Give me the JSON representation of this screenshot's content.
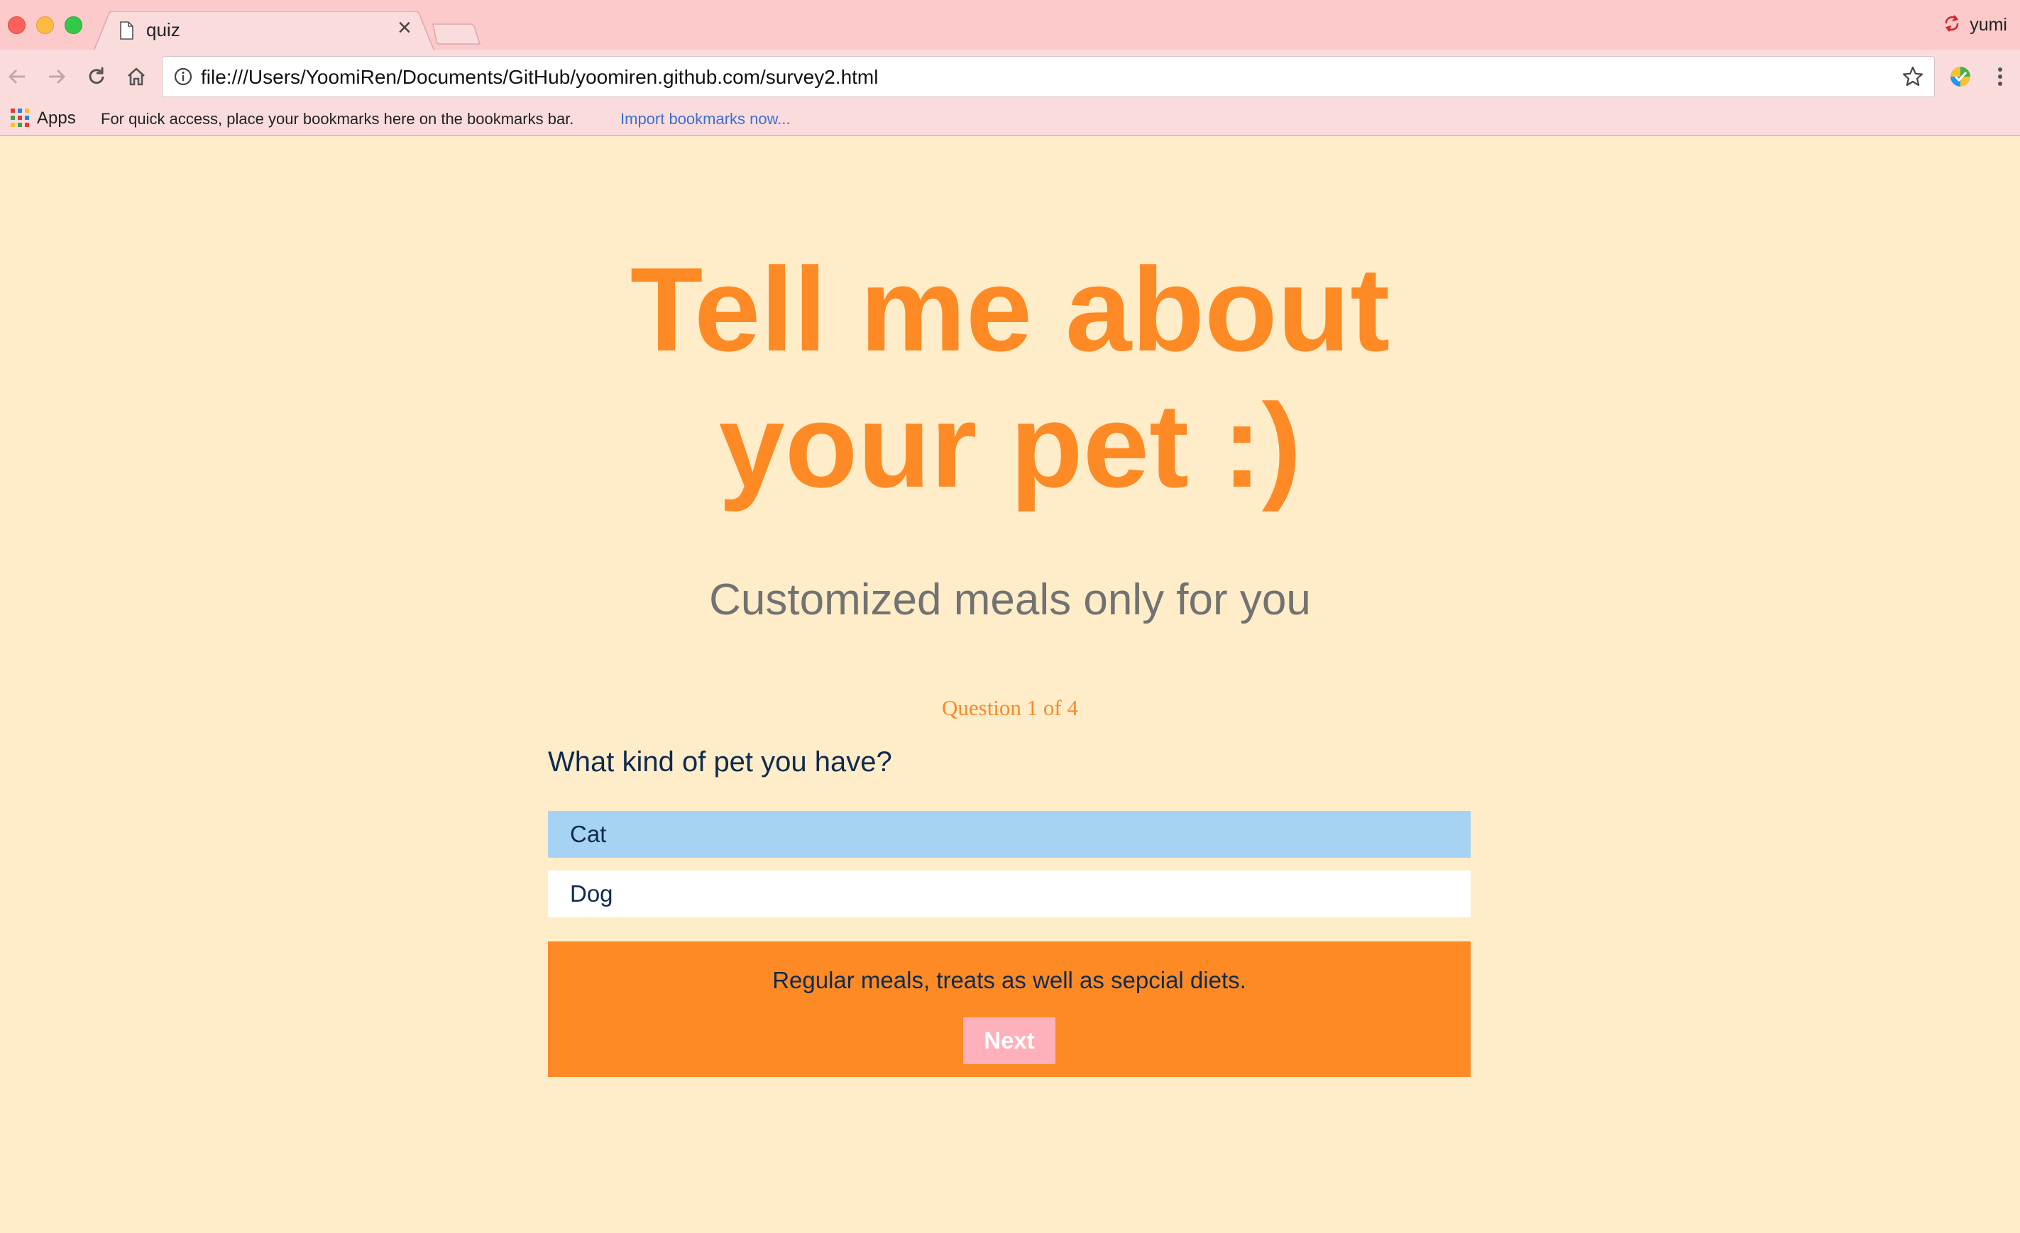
{
  "browser": {
    "tab": {
      "title": "quiz",
      "close_glyph": "×"
    },
    "profile": {
      "name": "yumi"
    },
    "address": {
      "url": "file:///Users/YoomiRen/Documents/GitHub/yoomiren.github.com/survey2.html"
    },
    "bookmarks_bar": {
      "apps_label": "Apps",
      "hint": "For quick access, place your bookmarks here on the bookmarks bar.",
      "import_link": "Import bookmarks now..."
    },
    "icons": [
      "page-icon",
      "back-icon",
      "forward-icon",
      "reload-icon",
      "home-icon",
      "info-icon",
      "star-icon",
      "extension-icon",
      "menu-icon",
      "apps-icon",
      "sync-icon"
    ]
  },
  "page": {
    "headline_line1": "Tell me about",
    "headline_line2": "your pet :)",
    "subheadline": "Customized meals only for you",
    "progress": "Question 1 of 4",
    "question": "What kind of pet you have?",
    "options": [
      {
        "label": "Cat",
        "selected": true
      },
      {
        "label": "Dog",
        "selected": false
      }
    ],
    "footer_text": "Regular meals, treats as well as sepcial diets.",
    "next_label": "Next"
  },
  "colors": {
    "page_background": "#feedc8",
    "accent_orange": "#fe8a26",
    "selected_option": "#a6d3f3",
    "next_button": "#ffb1bb",
    "question_text": "#0e2b4f",
    "tabstrip": "#fccaca"
  }
}
